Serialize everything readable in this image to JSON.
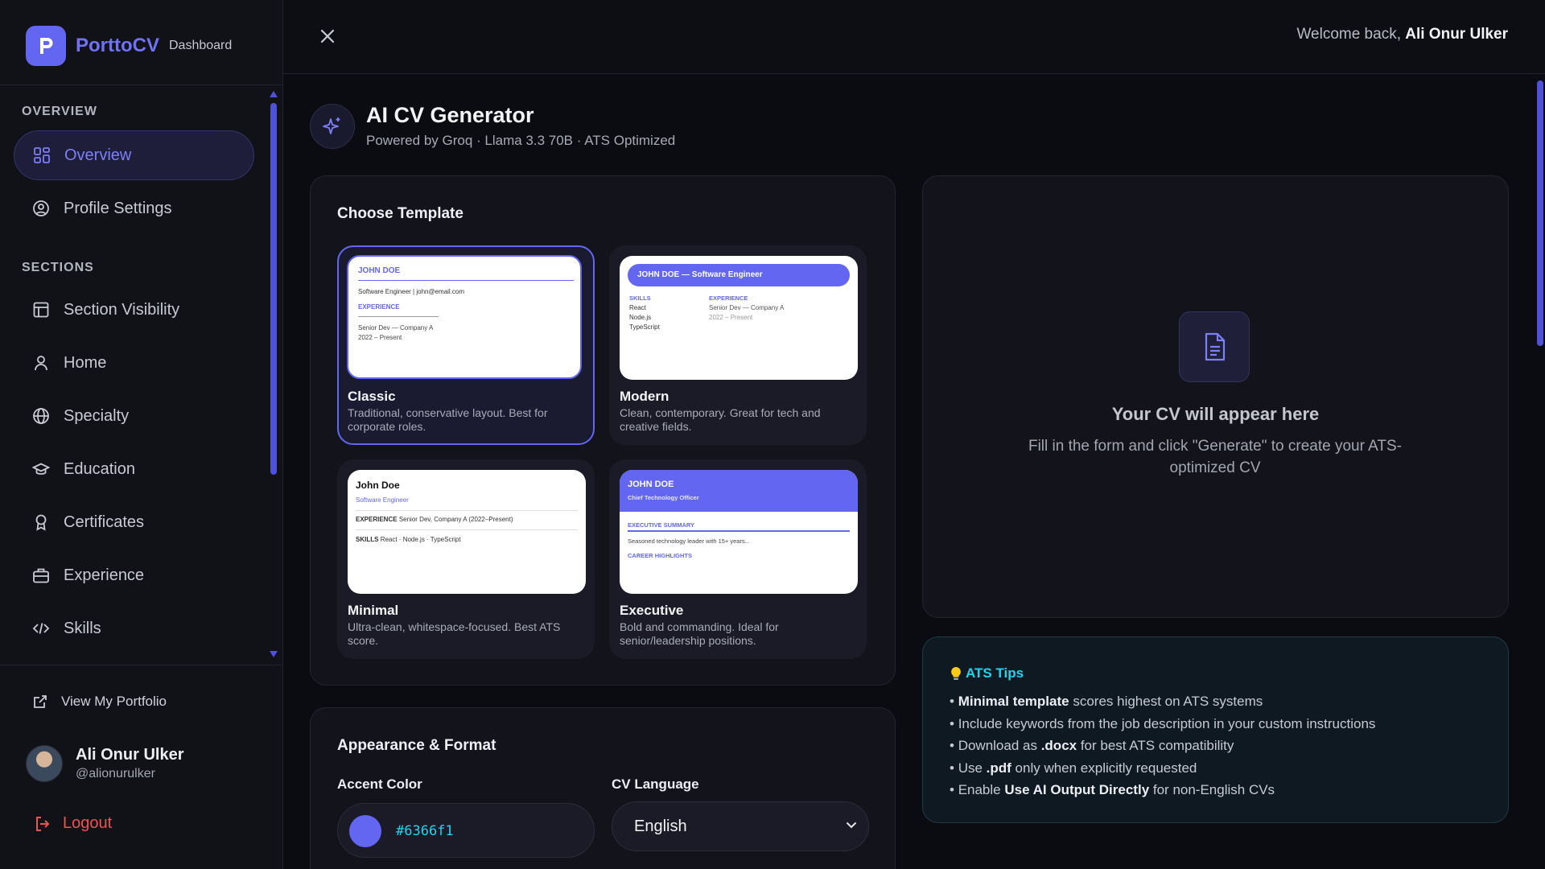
{
  "brand": {
    "name": "PorttoCV",
    "section": "Dashboard",
    "logo_letter": "P"
  },
  "colors": {
    "accent": "#6366f1",
    "danger": "#f05252",
    "cyan": "#22d3ee"
  },
  "sidebar": {
    "overview_label": "OVERVIEW",
    "sections_label": "SECTIONS",
    "items": [
      {
        "label": "Overview",
        "icon": "grid-icon",
        "active": true
      },
      {
        "label": "Profile Settings",
        "icon": "user-circle-icon"
      },
      {
        "label": "Section Visibility",
        "icon": "layout-icon"
      },
      {
        "label": "Home",
        "icon": "user-icon"
      },
      {
        "label": "Specialty",
        "icon": "globe-icon"
      },
      {
        "label": "Education",
        "icon": "graduation-cap-icon"
      },
      {
        "label": "Certificates",
        "icon": "award-icon"
      },
      {
        "label": "Experience",
        "icon": "briefcase-icon"
      },
      {
        "label": "Skills",
        "icon": "code-icon"
      }
    ],
    "view_portfolio": "View My Portfolio",
    "user": {
      "name": "Ali Onur Ulker",
      "handle": "@alionurulker"
    },
    "logout": "Logout"
  },
  "topbar": {
    "welcome_prefix": "Welcome back,",
    "user_name": "Ali Onur Ulker"
  },
  "page": {
    "title": "AI CV Generator",
    "subtitle": "Powered by Groq · Llama 3.3 70B · ATS Optimized"
  },
  "templates": {
    "title": "Choose Template",
    "selected": "Classic",
    "items": [
      {
        "name": "Classic",
        "desc": "Traditional, conservative layout. Best for corporate roles.",
        "preview": {
          "name": "JOHN DOE",
          "line1": "Software Engineer | john@email.com",
          "heading": "EXPERIENCE",
          "line2": "Senior Dev — Company A",
          "line3": "2022 – Present"
        }
      },
      {
        "name": "Modern",
        "desc": "Clean, contemporary. Great for tech and creative fields.",
        "preview": {
          "header": "JOHN DOE — Software Engineer",
          "skills_heading": "SKILLS",
          "skills": [
            "React",
            "Node.js",
            "TypeScript"
          ],
          "exp_heading": "EXPERIENCE",
          "exp_line": "Senior Dev — Company A",
          "exp_date": "2022 – Present"
        }
      },
      {
        "name": "Minimal",
        "desc": "Ultra-clean, whitespace-focused. Best ATS score.",
        "preview": {
          "name": "John Doe",
          "role": "Software Engineer",
          "exp_label": "EXPERIENCE",
          "exp_text": "Senior Dev, Company A (2022–Present)",
          "skills_label": "SKILLS",
          "skills_text": "React · Node.js · TypeScript"
        }
      },
      {
        "name": "Executive",
        "desc": "Bold and commanding. Ideal for senior/leadership positions.",
        "preview": {
          "name": "JOHN DOE",
          "role": "Chief Technology Officer",
          "summary_heading": "EXECUTIVE SUMMARY",
          "summary_text": "Seasoned technology leader with 15+ years...",
          "highlights_heading": "CAREER HIGHLIGHTS"
        }
      }
    ]
  },
  "appearance": {
    "title": "Appearance & Format",
    "accent_label": "Accent Color",
    "accent_value": "#6366f1",
    "language_label": "CV Language",
    "language_value": "English"
  },
  "preview": {
    "title": "Your CV will appear here",
    "desc": "Fill in the form and click \"Generate\" to create your ATS-optimized CV"
  },
  "tips": {
    "title": "ATS Tips",
    "items": [
      {
        "bold": "Minimal template",
        "text": " scores highest on ATS systems",
        "pre": ""
      },
      {
        "bold": "",
        "text": "Include keywords from the job description in your custom instructions",
        "pre": ""
      },
      {
        "pre": "Download as ",
        "bold": ".docx",
        "text": " for best ATS compatibility"
      },
      {
        "pre": "Use ",
        "bold": ".pdf",
        "text": " only when explicitly requested"
      },
      {
        "pre": "Enable ",
        "bold": "Use AI Output Directly",
        "text": " for non-English CVs"
      }
    ]
  }
}
